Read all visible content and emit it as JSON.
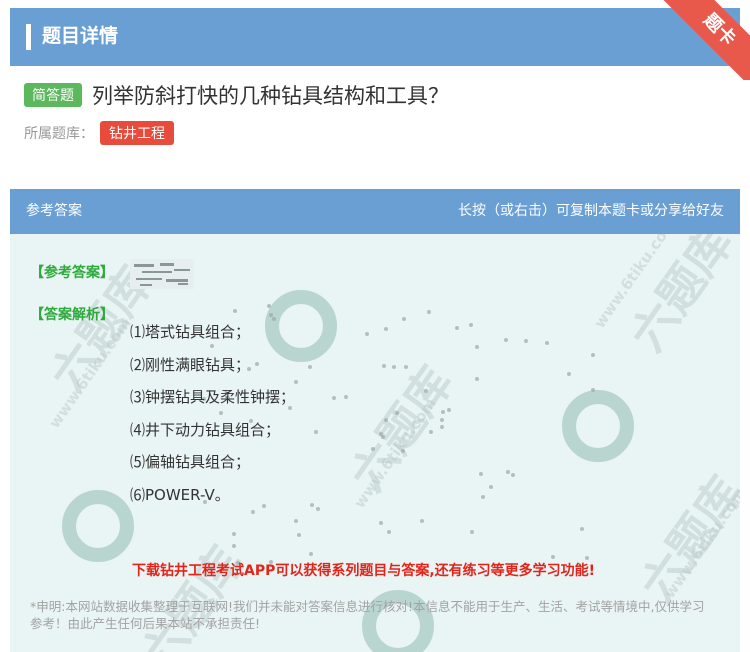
{
  "header": {
    "title": "题目详情"
  },
  "ribbon": {
    "label": "题卡"
  },
  "question": {
    "type_badge": "简答题",
    "text": "列举防斜打快的几种钻具结构和工具？",
    "bank_label": "所属题库：",
    "bank_tag": "钻井工程"
  },
  "answer_section": {
    "header_left": "参考答案",
    "header_right": "长按（或右击）可复制本题卡或分享给好友",
    "answer_label": "【参考答案】",
    "analysis_label": "【答案解析】",
    "analysis_items": [
      "⑴塔式钻具组合；",
      "⑵刚性满眼钻具；",
      "⑶钟摆钻具及柔性钟摆；",
      "⑷井下动力钻具组合；",
      "⑸偏轴钻具组合；",
      "⑹POWER-V。"
    ],
    "promo": "下载钻井工程考试APP可以获得系列题目与答案,还有练习等更多学习功能!",
    "disclaimer": "*申明:本网站数据收集整理于互联网!我们并未能对答案信息进行核对!本信息不能用于生产、生活、考试等情境中,仅供学习参考！由此产生任何后果本站不承担责任!"
  },
  "watermark": {
    "brand": "六题库",
    "url": "www.6tiku.com"
  },
  "colors": {
    "header_blue": "#6a9fd4",
    "badge_green": "#5cb85c",
    "tag_red": "#e64b3b",
    "answer_green": "#2eaa3c",
    "promo_red": "#e2241a",
    "panel_bg": "#e9f4f4"
  }
}
